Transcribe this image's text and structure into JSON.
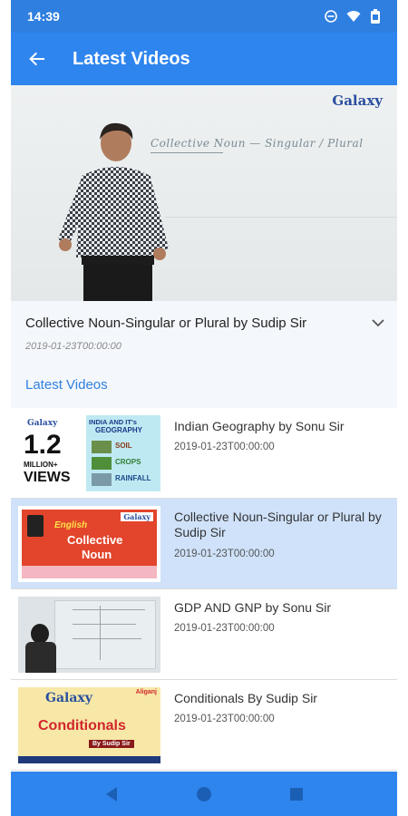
{
  "status_bar": {
    "time": "14:39"
  },
  "app_bar": {
    "title": "Latest Videos"
  },
  "player": {
    "whiteboard_text": "Collective Noun — Singular / Plural",
    "logo_text": "Galaxy"
  },
  "now_playing": {
    "title": "Collective Noun-Singular or Plural by Sudip Sir",
    "date": "2019-01-23T00:00:00"
  },
  "section_title": "Latest Videos",
  "videos": [
    {
      "title": "Indian Geography by Sonu Sir",
      "date": "2019-01-23T00:00:00",
      "thumb": {
        "big": "1.2",
        "mid": "MILLION+",
        "small": "VIEWS",
        "logo": "Galaxy",
        "head1": "INDIA AND IT's",
        "head2": "GEOGRAPHY",
        "row1": "SOIL",
        "row2": "CROPS",
        "row3": "RAINFALL"
      }
    },
    {
      "title": "Collective Noun-Singular or Plural by Sudip Sir",
      "date": "2019-01-23T00:00:00",
      "thumb": {
        "line1": "English",
        "line2": "Collective",
        "line3": "Noun",
        "logo": "Galaxy"
      }
    },
    {
      "title": "GDP AND GNP by Sonu Sir",
      "date": "2019-01-23T00:00:00"
    },
    {
      "title": "Conditionals By Sudip Sir",
      "date": "2019-01-23T00:00:00",
      "thumb": {
        "logo": "Galaxy",
        "tag": "Aliganj",
        "head": "Conditionals",
        "by": "By Sudip Sir"
      }
    }
  ],
  "colors": {
    "primary": "#2f85ee",
    "selected": "#cfe2fa",
    "accent_text": "#2f7fe0"
  }
}
